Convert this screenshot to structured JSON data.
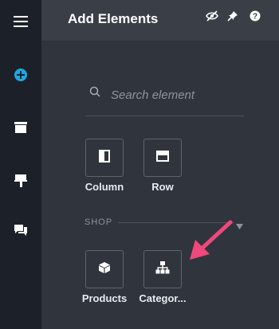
{
  "sidebar": {
    "items": [
      {
        "name": "menu-icon"
      },
      {
        "name": "add-circle-icon",
        "active": true
      },
      {
        "name": "folder-icon"
      },
      {
        "name": "paint-roller-icon"
      },
      {
        "name": "chat-icon"
      }
    ]
  },
  "header": {
    "title": "Add Elements",
    "icons": [
      "eye-off-icon",
      "pin-icon",
      "help-icon"
    ]
  },
  "search": {
    "placeholder": "Search element",
    "value": ""
  },
  "elements": [
    {
      "label": "Column",
      "icon": "column-icon"
    },
    {
      "label": "Row",
      "icon": "row-icon"
    }
  ],
  "shop": {
    "label": "SHOP",
    "items": [
      {
        "label": "Products",
        "icon": "cube-icon"
      },
      {
        "label": "Categor...",
        "icon": "sitemap-icon"
      }
    ]
  },
  "colors": {
    "accent": "#1ea7e1",
    "arrow": "#f0487a",
    "rail": "#1c2129",
    "panel": "#30353d",
    "header": "#3a3f47"
  }
}
